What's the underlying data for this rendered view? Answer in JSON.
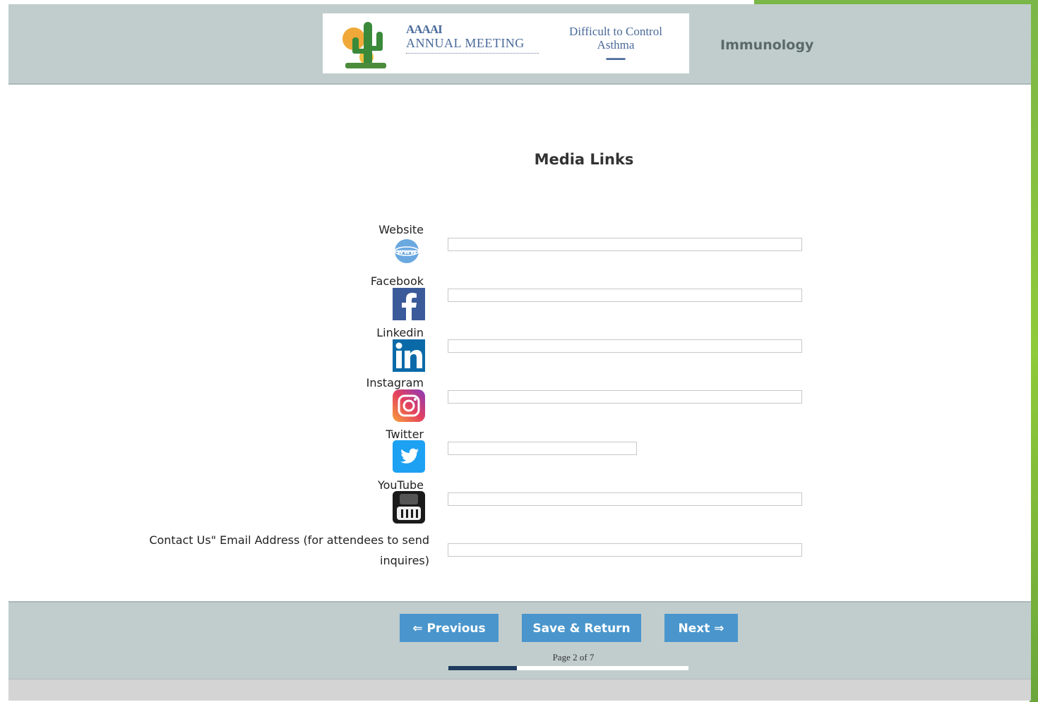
{
  "header": {
    "banner": {
      "org_text": "AAAAI",
      "meeting_title": "ANNUAL MEETING",
      "topic": "Difficult to Control Asthma"
    },
    "specialty": "Immunology"
  },
  "main": {
    "heading": "Media Links",
    "fields": [
      {
        "label": "Website",
        "icon": "globe-icon",
        "value": ""
      },
      {
        "label": "Facebook",
        "icon": "facebook-icon",
        "value": ""
      },
      {
        "label": "Linkedin",
        "icon": "linkedin-icon",
        "value": ""
      },
      {
        "label": "Instagram",
        "icon": "instagram-icon",
        "value": ""
      },
      {
        "label": "Twitter",
        "icon": "twitter-icon",
        "value": ""
      },
      {
        "label": "YouTube",
        "icon": "youtube-icon",
        "value": ""
      }
    ],
    "contact": {
      "label": "Contact Us\" Email Address (for attendees to send inquires)",
      "value": ""
    }
  },
  "footer": {
    "previous_label": "⇐ Previous",
    "save_label": "Save & Return",
    "next_label": "Next ⇒",
    "page_indicator": "Page 2 of 7",
    "progress": 0.2857
  },
  "colors": {
    "header_bg": "#c1cdcd",
    "button": "#4a96cc",
    "progress": "#1f3c5f",
    "accent_green": "#7ab648"
  }
}
